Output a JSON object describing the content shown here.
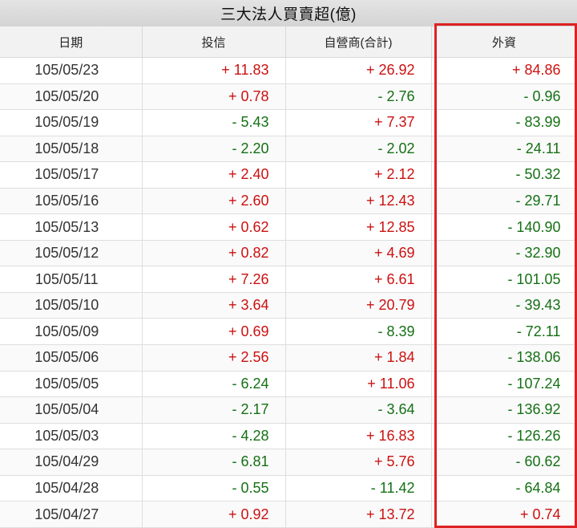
{
  "title": "三大法人買賣超(億)",
  "columns": [
    "日期",
    "投信",
    "自營商(合計)",
    "外資"
  ],
  "rows": [
    {
      "date": "105/05/23",
      "trust": "+ 11.83",
      "dealer": "+ 26.92",
      "foreign": "+ 84.86"
    },
    {
      "date": "105/05/20",
      "trust": "+ 0.78",
      "dealer": "- 2.76",
      "foreign": "- 0.96"
    },
    {
      "date": "105/05/19",
      "trust": "- 5.43",
      "dealer": "+ 7.37",
      "foreign": "- 83.99"
    },
    {
      "date": "105/05/18",
      "trust": "- 2.20",
      "dealer": "- 2.02",
      "foreign": "- 24.11"
    },
    {
      "date": "105/05/17",
      "trust": "+ 2.40",
      "dealer": "+ 2.12",
      "foreign": "- 50.32"
    },
    {
      "date": "105/05/16",
      "trust": "+ 2.60",
      "dealer": "+ 12.43",
      "foreign": "- 29.71"
    },
    {
      "date": "105/05/13",
      "trust": "+ 0.62",
      "dealer": "+ 12.85",
      "foreign": "- 140.90"
    },
    {
      "date": "105/05/12",
      "trust": "+ 0.82",
      "dealer": "+ 4.69",
      "foreign": "- 32.90"
    },
    {
      "date": "105/05/11",
      "trust": "+ 7.26",
      "dealer": "+ 6.61",
      "foreign": "- 101.05"
    },
    {
      "date": "105/05/10",
      "trust": "+ 3.64",
      "dealer": "+ 20.79",
      "foreign": "- 39.43"
    },
    {
      "date": "105/05/09",
      "trust": "+ 0.69",
      "dealer": "- 8.39",
      "foreign": "- 72.11"
    },
    {
      "date": "105/05/06",
      "trust": "+ 2.56",
      "dealer": "+ 1.84",
      "foreign": "- 138.06"
    },
    {
      "date": "105/05/05",
      "trust": "- 6.24",
      "dealer": "+ 11.06",
      "foreign": "- 107.24"
    },
    {
      "date": "105/05/04",
      "trust": "- 2.17",
      "dealer": "- 3.64",
      "foreign": "- 136.92"
    },
    {
      "date": "105/05/03",
      "trust": "- 4.28",
      "dealer": "+ 16.83",
      "foreign": "- 126.26"
    },
    {
      "date": "105/04/29",
      "trust": "- 6.81",
      "dealer": "+ 5.76",
      "foreign": "- 60.62"
    },
    {
      "date": "105/04/28",
      "trust": "- 0.55",
      "dealer": "- 11.42",
      "foreign": "- 64.84"
    },
    {
      "date": "105/04/27",
      "trust": "+ 0.92",
      "dealer": "+ 13.72",
      "foreign": "+ 0.74"
    }
  ],
  "colors": {
    "positive": "#cc1111",
    "negative": "#157015",
    "highlight_border": "#dd2222"
  }
}
